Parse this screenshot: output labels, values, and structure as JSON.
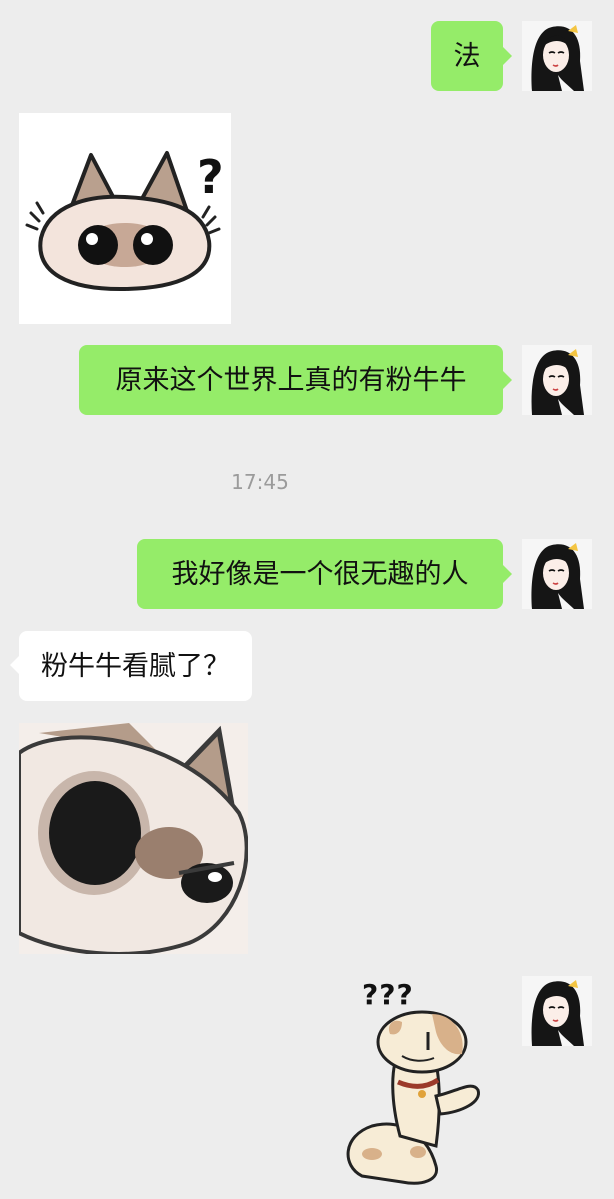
{
  "messages": [
    {
      "side": "mine",
      "type": "text",
      "text": "法"
    },
    {
      "side": "theirs",
      "type": "sticker",
      "sticker": "cat-question-sticker"
    },
    {
      "side": "mine",
      "type": "text",
      "text": "原来这个世界上真的有粉牛牛"
    },
    {
      "side": "system",
      "type": "time",
      "text": "17:45"
    },
    {
      "side": "mine",
      "type": "text",
      "text": "我好像是一个很无趣的人"
    },
    {
      "side": "theirs",
      "type": "text",
      "text": "粉牛牛看腻了？"
    },
    {
      "side": "theirs",
      "type": "sticker",
      "sticker": "cat-closeup-sticker"
    },
    {
      "side": "mine",
      "type": "sticker",
      "sticker": "snake-question-sticker",
      "text": "???"
    }
  ],
  "colors": {
    "background": "#ededed",
    "my_bubble": "#95ec69",
    "their_bubble": "#ffffff",
    "timestamp_text": "#9b9b9b"
  },
  "icons": {
    "avatar": "anime-girl-avatar"
  }
}
